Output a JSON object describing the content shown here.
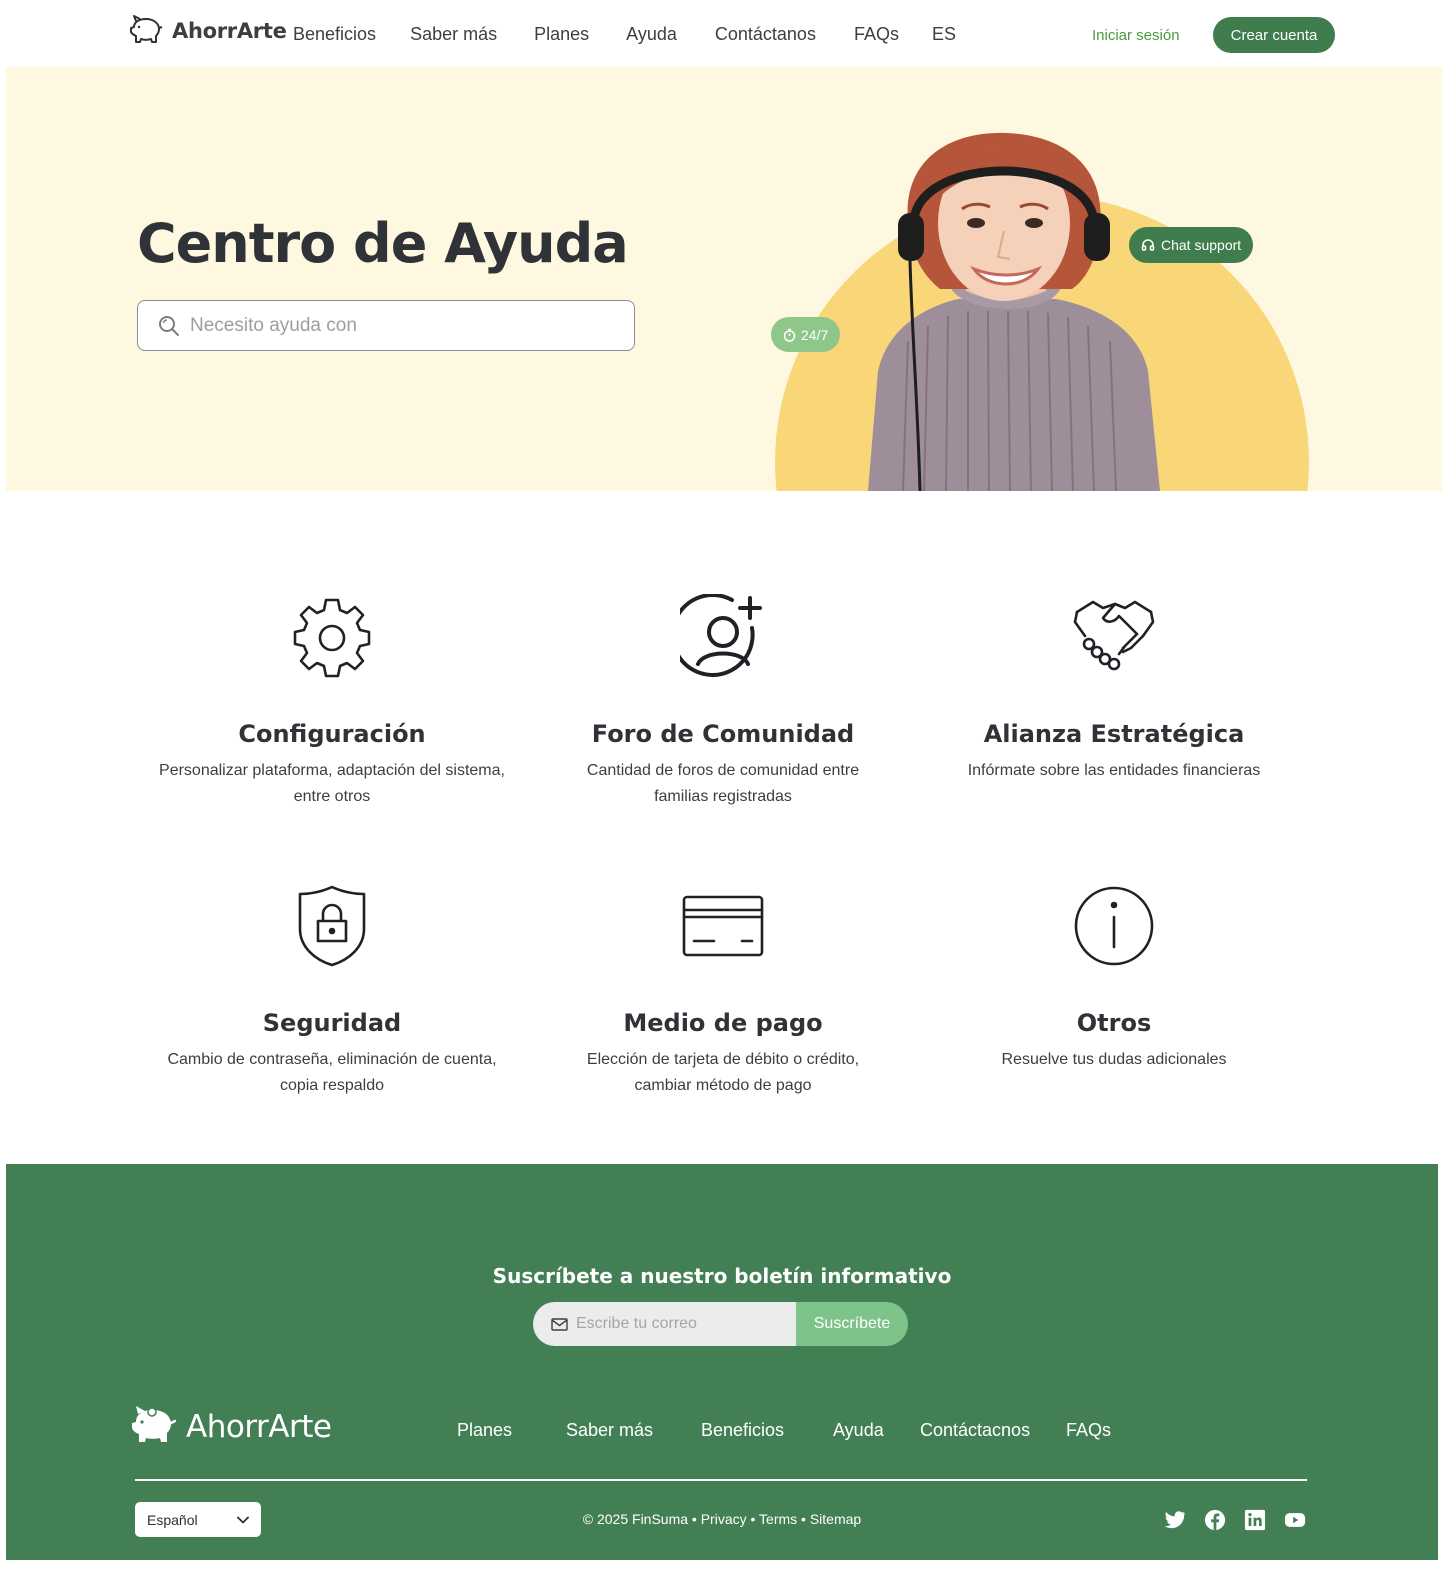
{
  "brand": {
    "name": "AhorrArte"
  },
  "nav": {
    "links": [
      "Beneficios",
      "Saber más",
      "Planes",
      "Ayuda",
      "Contáctanos",
      "FAQs",
      "ES"
    ],
    "login": "Iniciar sesión",
    "signup": "Crear cuenta"
  },
  "hero": {
    "title": "Centro de Ayuda",
    "search_placeholder": "Necesito ayuda con",
    "chat_badge": "Chat support",
    "availability_badge": "24/7"
  },
  "categories": [
    {
      "icon": "gear-icon",
      "title": "Configuración",
      "desc_line1": "Personalizar plataforma, adaptación del sistema,",
      "desc_line2": "entre otros"
    },
    {
      "icon": "user-add-icon",
      "title": "Foro de Comunidad",
      "desc_line1": "Cantidad de foros de comunidad entre",
      "desc_line2": "familias registradas"
    },
    {
      "icon": "handshake-icon",
      "title": "Alianza Estratégica",
      "desc_line1": "Infórmate sobre las entidades financieras",
      "desc_line2": ""
    },
    {
      "icon": "shield-lock-icon",
      "title": "Seguridad",
      "desc_line1": "Cambio de contraseña, eliminación de cuenta,",
      "desc_line2": "copia respaldo"
    },
    {
      "icon": "credit-card-icon",
      "title": "Medio de pago",
      "desc_line1": "Elección de tarjeta de débito o crédito,",
      "desc_line2": "cambiar método de pago"
    },
    {
      "icon": "info-icon",
      "title": "Otros",
      "desc_line1": "Resuelve tus dudas adicionales",
      "desc_line2": ""
    }
  ],
  "footer": {
    "newsletter_title": "Suscríbete a nuestro boletín informativo",
    "email_placeholder": "Escribe tu correo",
    "subscribe": "Suscríbete",
    "brand": "AhorrArte",
    "links": [
      "Planes",
      "Saber más",
      "Beneficios",
      "Ayuda",
      "Contáctacnos",
      "FAQs"
    ],
    "language": "Español",
    "copyright": "© 2025 FinSuma • Privacy • Terms • Sitemap",
    "social": [
      "twitter-icon",
      "facebook-icon",
      "linkedin-icon",
      "youtube-icon"
    ]
  },
  "colors": {
    "brand_green": "#3f7d4e",
    "footer_green": "#437f54",
    "hero_bg": "#fff8e0",
    "sun_yellow": "#f9d678",
    "light_green": "#7ec48a",
    "login_green": "#4a9a3f"
  }
}
